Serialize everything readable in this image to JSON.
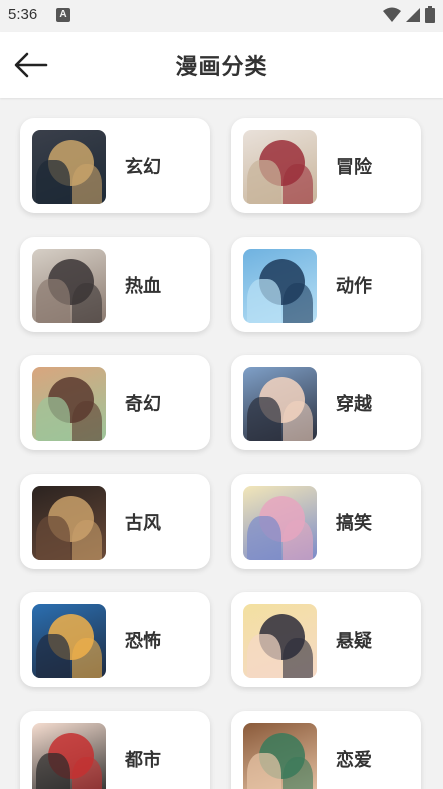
{
  "status_bar": {
    "time": "5:36",
    "app_icon": "A"
  },
  "header": {
    "title": "漫画分类"
  },
  "categories": [
    {
      "label": "玄幻",
      "thumb_colors": [
        "#3a3f4a",
        "#c9a46a",
        "#1e2a36"
      ]
    },
    {
      "label": "冒险",
      "thumb_colors": [
        "#e9e1da",
        "#9b2f3a",
        "#c8b49a"
      ]
    },
    {
      "label": "热血",
      "thumb_colors": [
        "#d6cfc6",
        "#3b3536",
        "#8b7a70"
      ]
    },
    {
      "label": "动作",
      "thumb_colors": [
        "#6fb2e0",
        "#1d3b5c",
        "#b8e0f5"
      ]
    },
    {
      "label": "奇幻",
      "thumb_colors": [
        "#d9a57e",
        "#5b3a2f",
        "#9cc59a"
      ]
    },
    {
      "label": "穿越",
      "thumb_colors": [
        "#7fa0c8",
        "#f3d3c0",
        "#2b2f3c"
      ]
    },
    {
      "label": "古风",
      "thumb_colors": [
        "#2b2320",
        "#c9a06a",
        "#6a4a38"
      ]
    },
    {
      "label": "搞笑",
      "thumb_colors": [
        "#f2e6b8",
        "#e6a6c0",
        "#7a8ac9"
      ]
    },
    {
      "label": "恐怖",
      "thumb_colors": [
        "#2b6fb1",
        "#f0b04a",
        "#1f2b40"
      ]
    },
    {
      "label": "悬疑",
      "thumb_colors": [
        "#f3e0a0",
        "#2b2b3a",
        "#f5d9c6"
      ]
    },
    {
      "label": "都市",
      "thumb_colors": [
        "#f5ddd0",
        "#c43030",
        "#2a2a2a"
      ]
    },
    {
      "label": "恋爱",
      "thumb_colors": [
        "#8a5a3a",
        "#3a7a5a",
        "#e8c6a8"
      ]
    }
  ]
}
